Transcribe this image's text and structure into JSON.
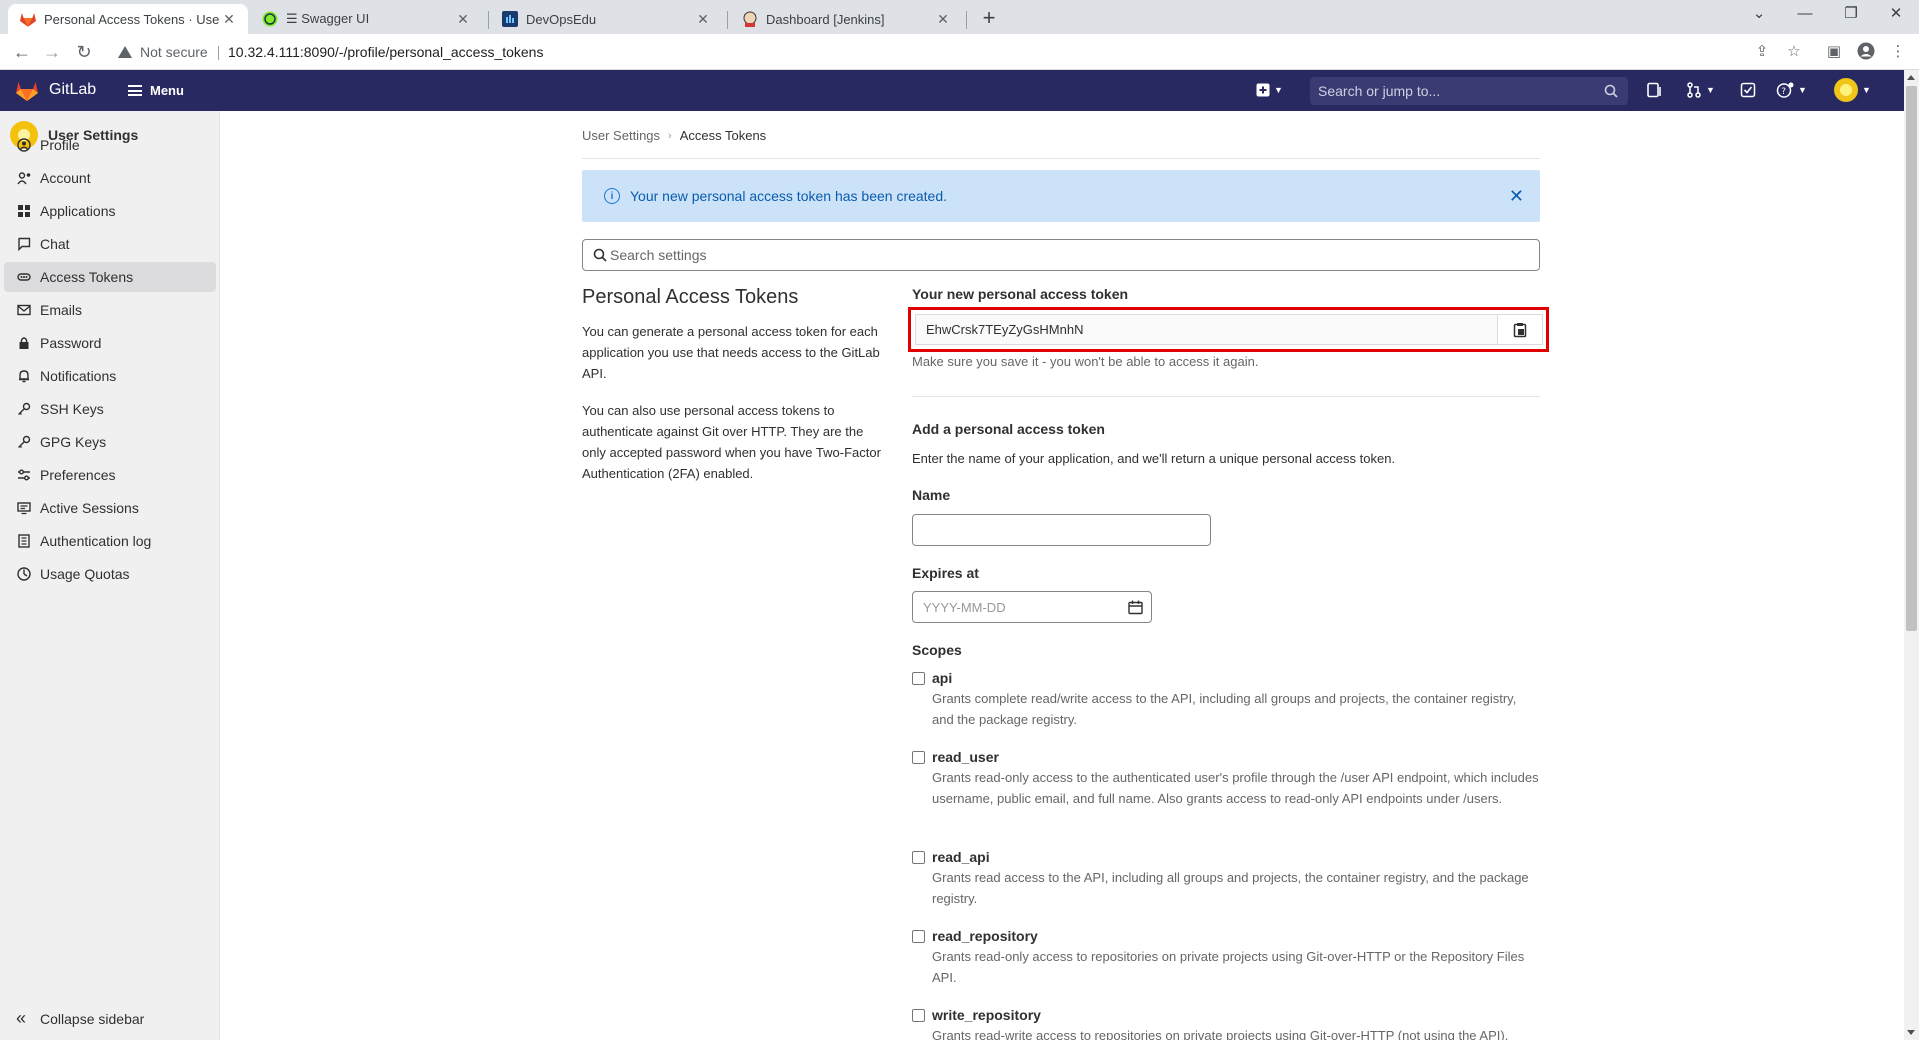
{
  "browser": {
    "tabs": [
      {
        "title": "Personal Access Tokens · User Se",
        "active": true
      },
      {
        "title": "☰ Swagger UI",
        "active": false
      },
      {
        "title": "DevOpsEdu",
        "active": false
      },
      {
        "title": "Dashboard [Jenkins]",
        "active": false
      }
    ],
    "security_label": "Not secure",
    "url": "10.32.4.111:8090/-/profile/personal_access_tokens"
  },
  "topnav": {
    "brand": "GitLab",
    "menu_label": "Menu",
    "search_placeholder": "Search or jump to..."
  },
  "sidebar": {
    "title": "User Settings",
    "items": [
      {
        "label": "Profile",
        "icon": "profile-icon"
      },
      {
        "label": "Account",
        "icon": "account-icon"
      },
      {
        "label": "Applications",
        "icon": "applications-icon"
      },
      {
        "label": "Chat",
        "icon": "chat-icon"
      },
      {
        "label": "Access Tokens",
        "icon": "token-icon",
        "active": true
      },
      {
        "label": "Emails",
        "icon": "email-icon"
      },
      {
        "label": "Password",
        "icon": "lock-icon"
      },
      {
        "label": "Notifications",
        "icon": "bell-icon"
      },
      {
        "label": "SSH Keys",
        "icon": "key-icon"
      },
      {
        "label": "GPG Keys",
        "icon": "key-icon"
      },
      {
        "label": "Preferences",
        "icon": "preferences-icon"
      },
      {
        "label": "Active Sessions",
        "icon": "monitor-icon"
      },
      {
        "label": "Authentication log",
        "icon": "log-icon"
      },
      {
        "label": "Usage Quotas",
        "icon": "quota-icon"
      }
    ],
    "collapse_label": "Collapse sidebar"
  },
  "breadcrumb": {
    "parent": "User Settings",
    "current": "Access Tokens"
  },
  "alert": {
    "message": "Your new personal access token has been created."
  },
  "search_settings": {
    "placeholder": "Search settings"
  },
  "section": {
    "title": "Personal Access Tokens",
    "desc1": "You can generate a personal access token for each application you use that needs access to the GitLab API.",
    "desc2": "You can also use personal access tokens to authenticate against Git over HTTP. They are the only accepted password when you have Two-Factor Authentication (2FA) enabled."
  },
  "new_token": {
    "label": "Your new personal access token",
    "value": "EhwCrsk7TEyZyGsHMnhN",
    "help": "Make sure you save it - you won't be able to access it again."
  },
  "add_token": {
    "title": "Add a personal access token",
    "desc": "Enter the name of your application, and we'll return a unique personal access token.",
    "name_label": "Name",
    "name_value": "",
    "expires_label": "Expires at",
    "expires_placeholder": "YYYY-MM-DD",
    "scopes_label": "Scopes"
  },
  "scopes": [
    {
      "name": "api",
      "desc": "Grants complete read/write access to the API, including all groups and projects, the container registry, and the package registry."
    },
    {
      "name": "read_user",
      "desc": "Grants read-only access to the authenticated user's profile through the /user API endpoint, which includes username, public email, and full name. Also grants access to read-only API endpoints under /users."
    },
    {
      "name": "read_api",
      "desc": "Grants read access to the API, including all groups and projects, the container registry, and the package registry."
    },
    {
      "name": "read_repository",
      "desc": "Grants read-only access to repositories on private projects using Git-over-HTTP or the Repository Files API."
    },
    {
      "name": "write_repository",
      "desc": "Grants read-write access to repositories on private projects using Git-over-HTTP (not using the API)."
    }
  ],
  "colors": {
    "nav_bg": "#292961",
    "alert_bg": "#cbe2f9",
    "highlight": "#e00000"
  }
}
